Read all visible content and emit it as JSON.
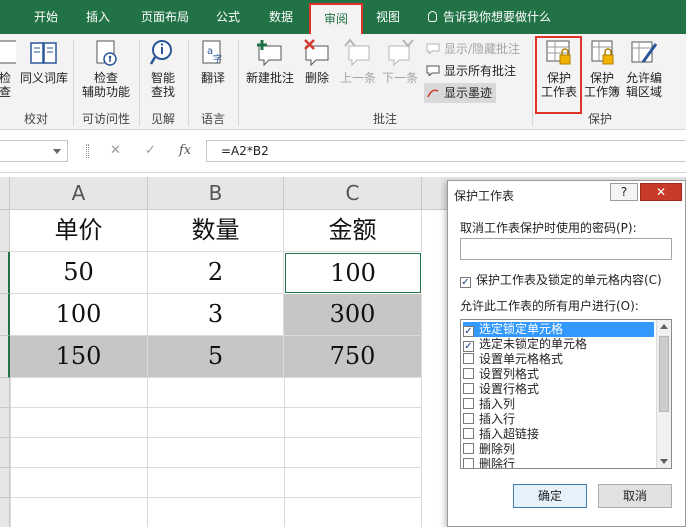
{
  "tabs": [
    {
      "id": "kaishi",
      "label": "开始"
    },
    {
      "id": "charu",
      "label": "插入"
    },
    {
      "id": "yemian",
      "label": "页面布局"
    },
    {
      "id": "gongshi",
      "label": "公式"
    },
    {
      "id": "shuju",
      "label": "数据"
    },
    {
      "id": "shenyue",
      "label": "审阅",
      "active": true
    },
    {
      "id": "shitu",
      "label": "视图"
    }
  ],
  "tellme": "告诉我你想要做什么",
  "ribbon": {
    "groups": {
      "proofing": "校对",
      "accessibility": "可访问性",
      "insights": "见解",
      "language": "语言",
      "comments": "批注",
      "protect": "保护"
    },
    "buttons": {
      "spell": "检查",
      "thesaurus": "同义词库",
      "check_access_1": "检查",
      "check_access_2": "辅助功能",
      "smart_1": "智能",
      "smart_2": "查找",
      "translate": "翻译",
      "new_comment": "新建批注",
      "delete": "删除",
      "prev": "上一条",
      "next": "下一条",
      "show_hide": "显示/隐藏批注",
      "show_all": "显示所有批注",
      "show_ink": "显示墨迹",
      "protect_sheet_1": "保护",
      "protect_sheet_2": "工作表",
      "protect_wb_1": "保护",
      "protect_wb_2": "工作簿",
      "allow_edit_1": "允许编",
      "allow_edit_2": "辑区域"
    }
  },
  "formula_bar": {
    "formula": "=A2*B2",
    "cancel_glyph": "✕",
    "enter_glyph": "✓",
    "fx_glyph": "fx"
  },
  "sheet": {
    "columns": [
      "A",
      "B",
      "C"
    ],
    "rows": [
      [
        "单价",
        "数量",
        "金额"
      ],
      [
        "50",
        "2",
        "100"
      ],
      [
        "100",
        "3",
        "300"
      ],
      [
        "150",
        "5",
        "750"
      ]
    ]
  },
  "dialog": {
    "title": "保护工作表",
    "help": "?",
    "close": "✕",
    "password_label": "取消工作表保护时使用的密码(P):",
    "password_value": "",
    "protect_label": "保护工作表及锁定的单元格内容(C)",
    "protect_checked": true,
    "allow_label": "允许此工作表的所有用户进行(O):",
    "permissions": [
      {
        "label": "选定锁定单元格",
        "checked": true
      },
      {
        "label": "选定未锁定的单元格",
        "checked": true
      },
      {
        "label": "设置单元格格式",
        "checked": false
      },
      {
        "label": "设置列格式",
        "checked": false
      },
      {
        "label": "设置行格式",
        "checked": false
      },
      {
        "label": "插入列",
        "checked": false
      },
      {
        "label": "插入行",
        "checked": false
      },
      {
        "label": "插入超链接",
        "checked": false
      },
      {
        "label": "删除列",
        "checked": false
      },
      {
        "label": "删除行",
        "checked": false
      }
    ],
    "ok": "确定",
    "cancel": "取消"
  },
  "colors": {
    "excel_green": "#217346",
    "highlight_red": "#e0332c",
    "selection_blue": "#3399ff",
    "gray_cell": "#c6c6c6"
  }
}
